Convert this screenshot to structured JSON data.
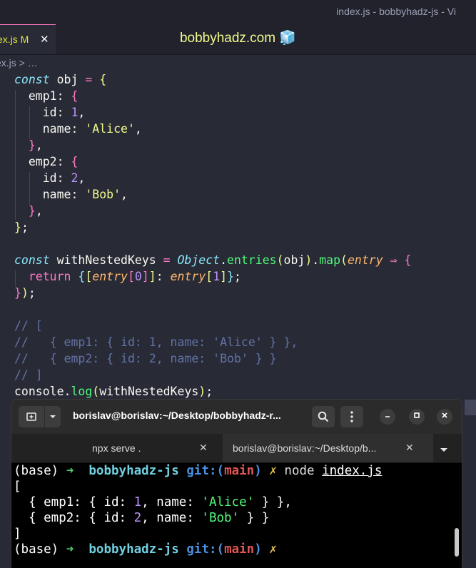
{
  "window": {
    "title": "index.js - bobbyhadz-js - Vi"
  },
  "editor": {
    "tab": {
      "label": "ex.js M",
      "close": "✕"
    },
    "site_title": "bobbyhadz.com",
    "site_icon": "🧊",
    "breadcrumb": "ex.js > …"
  },
  "code_lines": [
    [
      [
        "kw",
        "const"
      ],
      [
        "p",
        " obj "
      ],
      [
        "op",
        "="
      ],
      [
        "p",
        " "
      ],
      [
        "br1",
        "{"
      ]
    ],
    [
      [
        "p",
        "  emp1: "
      ],
      [
        "br2",
        "{"
      ]
    ],
    [
      [
        "p",
        "    id: "
      ],
      [
        "num",
        "1"
      ],
      [
        "p",
        ","
      ]
    ],
    [
      [
        "p",
        "    name: "
      ],
      [
        "str",
        "'Alice'"
      ],
      [
        "p",
        ","
      ]
    ],
    [
      [
        "p",
        "  "
      ],
      [
        "br2",
        "}"
      ],
      [
        "p",
        ","
      ]
    ],
    [
      [
        "p",
        "  emp2: "
      ],
      [
        "br2",
        "{"
      ]
    ],
    [
      [
        "p",
        "    id: "
      ],
      [
        "num",
        "2"
      ],
      [
        "p",
        ","
      ]
    ],
    [
      [
        "p",
        "    name: "
      ],
      [
        "str",
        "'Bob'"
      ],
      [
        "p",
        ","
      ]
    ],
    [
      [
        "p",
        "  "
      ],
      [
        "br2",
        "}"
      ],
      [
        "p",
        ","
      ]
    ],
    [
      [
        "br1",
        "}"
      ],
      [
        "p",
        ";"
      ]
    ],
    [
      [
        "p",
        ""
      ]
    ],
    [
      [
        "kw",
        "const"
      ],
      [
        "p",
        " withNestedKeys "
      ],
      [
        "op",
        "="
      ],
      [
        "p",
        " "
      ],
      [
        "cls",
        "Object"
      ],
      [
        "p",
        "."
      ],
      [
        "fn",
        "entries"
      ],
      [
        "br1",
        "("
      ],
      [
        "p",
        "obj"
      ],
      [
        "br1",
        ")"
      ],
      [
        "p",
        "."
      ],
      [
        "fn",
        "map"
      ],
      [
        "br1",
        "("
      ],
      [
        "param",
        "entry"
      ],
      [
        "p",
        " "
      ],
      [
        "op",
        "⇒"
      ],
      [
        "p",
        " "
      ],
      [
        "br2",
        "{"
      ]
    ],
    [
      [
        "p",
        "  "
      ],
      [
        "kw2",
        "return"
      ],
      [
        "p",
        " "
      ],
      [
        "br3",
        "{"
      ],
      [
        "br1",
        "["
      ],
      [
        "param",
        "entry"
      ],
      [
        "br2",
        "["
      ],
      [
        "num",
        "0"
      ],
      [
        "br2",
        "]"
      ],
      [
        "br1",
        "]"
      ],
      [
        "p",
        ": "
      ],
      [
        "param",
        "entry"
      ],
      [
        "br1",
        "["
      ],
      [
        "num",
        "1"
      ],
      [
        "br1",
        "]"
      ],
      [
        "br3",
        "}"
      ],
      [
        "p",
        ";"
      ]
    ],
    [
      [
        "br2",
        "}"
      ],
      [
        "br1",
        ")"
      ],
      [
        "p",
        ";"
      ]
    ],
    [
      [
        "p",
        ""
      ]
    ],
    [
      [
        "cmt",
        "// ["
      ]
    ],
    [
      [
        "cmt",
        "//   { emp1: { id: 1, name: 'Alice' } },"
      ]
    ],
    [
      [
        "cmt",
        "//   { emp2: { id: 2, name: 'Bob' } }"
      ]
    ],
    [
      [
        "cmt",
        "// ]"
      ]
    ],
    [
      [
        "p",
        "console."
      ],
      [
        "fn",
        "log"
      ],
      [
        "br1",
        "("
      ],
      [
        "p",
        "withNestedKeys"
      ],
      [
        "br1",
        ")"
      ],
      [
        "p",
        ";"
      ]
    ]
  ],
  "terminal": {
    "title": "borislav@borislav:~/Desktop/bobbyhadz-r...",
    "icons": {
      "new_tab": "new-tab-icon",
      "menu": "chevron-down-icon",
      "search": "search-icon",
      "more": "kebab-menu-icon"
    },
    "tabs": [
      {
        "label": "npx serve .",
        "close": "✕",
        "active": false
      },
      {
        "label": "borislav@borislav:~/Desktop/b...",
        "close": "✕",
        "active": true
      }
    ],
    "lines": [
      [
        [
          "t-plain",
          "(base) "
        ],
        [
          "t-arrow",
          "➜"
        ],
        [
          "t-plain",
          "  "
        ],
        [
          "t-dir",
          "bobbyhadz-js"
        ],
        [
          "t-plain",
          " "
        ],
        [
          "t-git",
          "git:("
        ],
        [
          "t-branch",
          "main"
        ],
        [
          "t-git",
          ")"
        ],
        [
          "t-plain",
          " "
        ],
        [
          "t-x",
          "✗"
        ],
        [
          "t-plain",
          " "
        ],
        [
          "t-cmd",
          "node"
        ],
        [
          "t-plain",
          " "
        ],
        [
          "t-file",
          "index.js"
        ]
      ],
      [
        [
          "t-plain",
          "["
        ]
      ],
      [
        [
          "t-plain",
          "  { emp1: { id: "
        ],
        [
          "t-num",
          "1"
        ],
        [
          "t-plain",
          ", name: "
        ],
        [
          "t-str",
          "'Alice'"
        ],
        [
          "t-plain",
          " } },"
        ]
      ],
      [
        [
          "t-plain",
          "  { emp2: { id: "
        ],
        [
          "t-num",
          "2"
        ],
        [
          "t-plain",
          ", name: "
        ],
        [
          "t-str",
          "'Bob'"
        ],
        [
          "t-plain",
          " } }"
        ]
      ],
      [
        [
          "t-plain",
          "]"
        ]
      ],
      [
        [
          "t-plain",
          "(base) "
        ],
        [
          "t-arrow",
          "➜"
        ],
        [
          "t-plain",
          "  "
        ],
        [
          "t-dir",
          "bobbyhadz-js"
        ],
        [
          "t-plain",
          " "
        ],
        [
          "t-git",
          "git:("
        ],
        [
          "t-branch",
          "main"
        ],
        [
          "t-git",
          ")"
        ],
        [
          "t-plain",
          " "
        ],
        [
          "t-x",
          "✗"
        ]
      ]
    ]
  }
}
